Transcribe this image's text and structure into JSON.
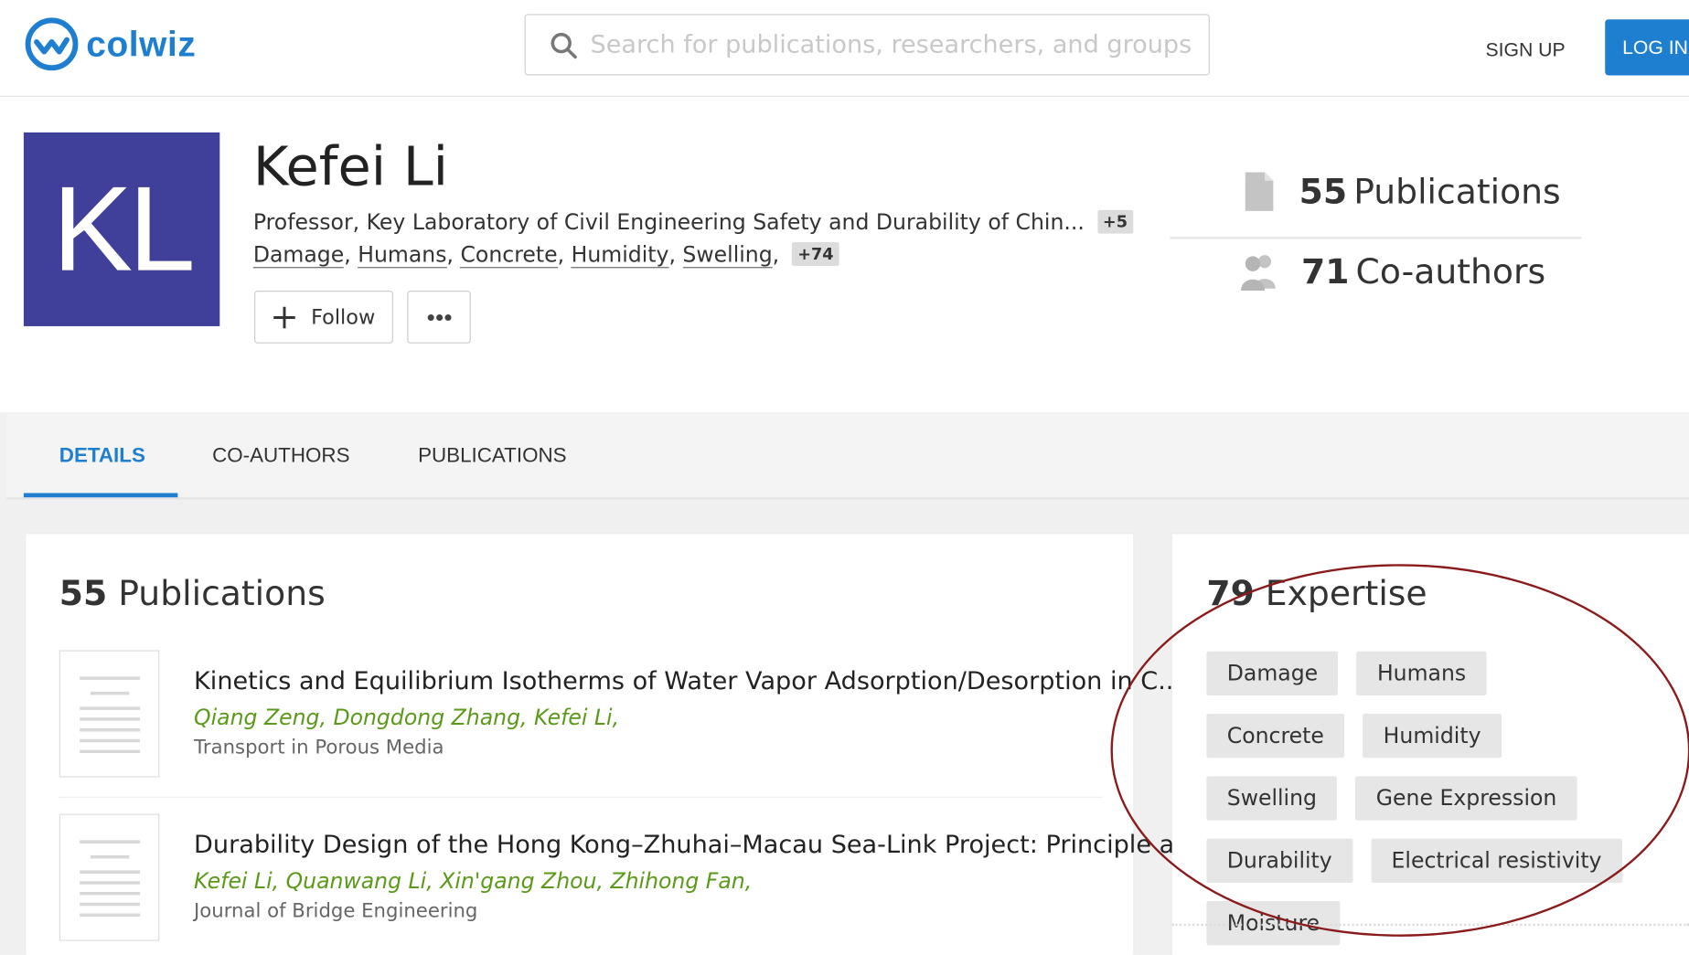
{
  "header": {
    "logo_text": "colwiz",
    "search_placeholder": "Search for publications, researchers, and groups",
    "signup_label": "SIGN UP",
    "login_label": "LOG IN"
  },
  "profile": {
    "initials": "KL",
    "name": "Kefei Li",
    "affiliation": "Professor, Key Laboratory of Civil Engineering Safety and Durability of Chin...",
    "affiliation_more": "+5",
    "tags": [
      "Damage",
      "Humans",
      "Concrete",
      "Humidity",
      "Swelling"
    ],
    "tags_more": "+74",
    "follow_label": "Follow",
    "stats": {
      "publications_count": "55",
      "publications_label": "Publications",
      "coauthors_count": "71",
      "coauthors_label": "Co-authors"
    }
  },
  "tabs": [
    "DETAILS",
    "CO-AUTHORS",
    "PUBLICATIONS"
  ],
  "publications": {
    "count": "55",
    "label": "Publications",
    "items": [
      {
        "title": "Kinetics and Equilibrium Isotherms of Water Vapor Adsorption/Desorption in C...",
        "authors": "Qiang Zeng, Dongdong Zhang, Kefei Li,",
        "journal": "Transport in Porous Media"
      },
      {
        "title": "Durability Design of the Hong Kong–Zhuhai–Macau Sea-Link Project: Principle a...",
        "authors": "Kefei Li, Quanwang Li, Xin'gang Zhou, Zhihong Fan,",
        "journal": "Journal of Bridge Engineering"
      }
    ]
  },
  "expertise": {
    "count": "79",
    "label": "Expertise",
    "chips": [
      "Damage",
      "Humans",
      "Concrete",
      "Humidity",
      "Swelling",
      "Gene Expression",
      "Durability",
      "Electrical resistivity",
      "Moisture"
    ]
  },
  "colors": {
    "accent": "#1e7fd0",
    "avatar_bg": "#403f9a",
    "author_green": "#5a9a18",
    "annotation_circle": "#8b1a1a"
  }
}
